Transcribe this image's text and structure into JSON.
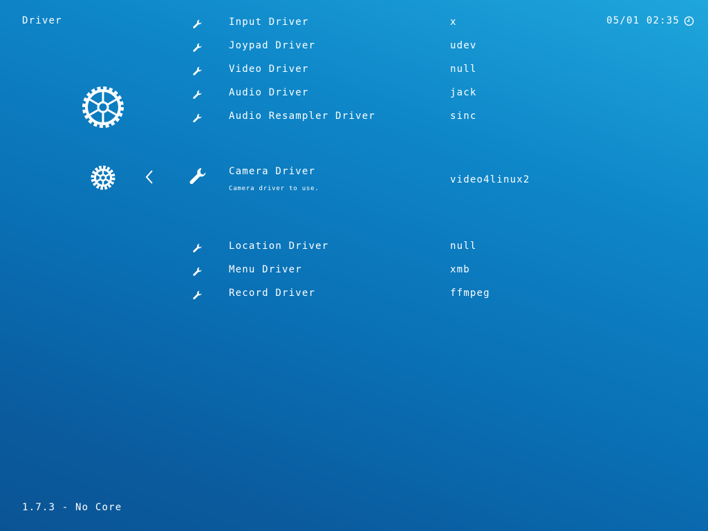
{
  "header": {
    "title": "Driver"
  },
  "clock": {
    "time": "05/01 02:35",
    "icon": "clock-icon"
  },
  "footer": {
    "version": "1.7.3 - No Core"
  },
  "sidebar": {
    "category_icon": "settings-gear-icon",
    "back_icon": "chevron-left-icon"
  },
  "menu": {
    "items": [
      {
        "label": "Input Driver",
        "value": "x",
        "icon": "wrench-icon"
      },
      {
        "label": "Joypad Driver",
        "value": "udev",
        "icon": "wrench-icon"
      },
      {
        "label": "Video Driver",
        "value": "null",
        "icon": "wrench-icon"
      },
      {
        "label": "Audio Driver",
        "value": "jack",
        "icon": "wrench-icon"
      },
      {
        "label": "Audio Resampler Driver",
        "value": "sinc",
        "icon": "wrench-icon"
      },
      {
        "label": "Camera Driver",
        "value": "video4linux2",
        "sublabel": "Camera driver to use.",
        "icon": "wrench-icon",
        "selected": true
      },
      {
        "label": "Location Driver",
        "value": "null",
        "icon": "wrench-icon"
      },
      {
        "label": "Menu Driver",
        "value": "xmb",
        "icon": "wrench-icon"
      },
      {
        "label": "Record Driver",
        "value": "ffmpeg",
        "icon": "wrench-icon"
      }
    ]
  },
  "colors": {
    "background_top": "#1fa6dc",
    "background_bottom": "#0b5494",
    "text": "#ffffff"
  }
}
